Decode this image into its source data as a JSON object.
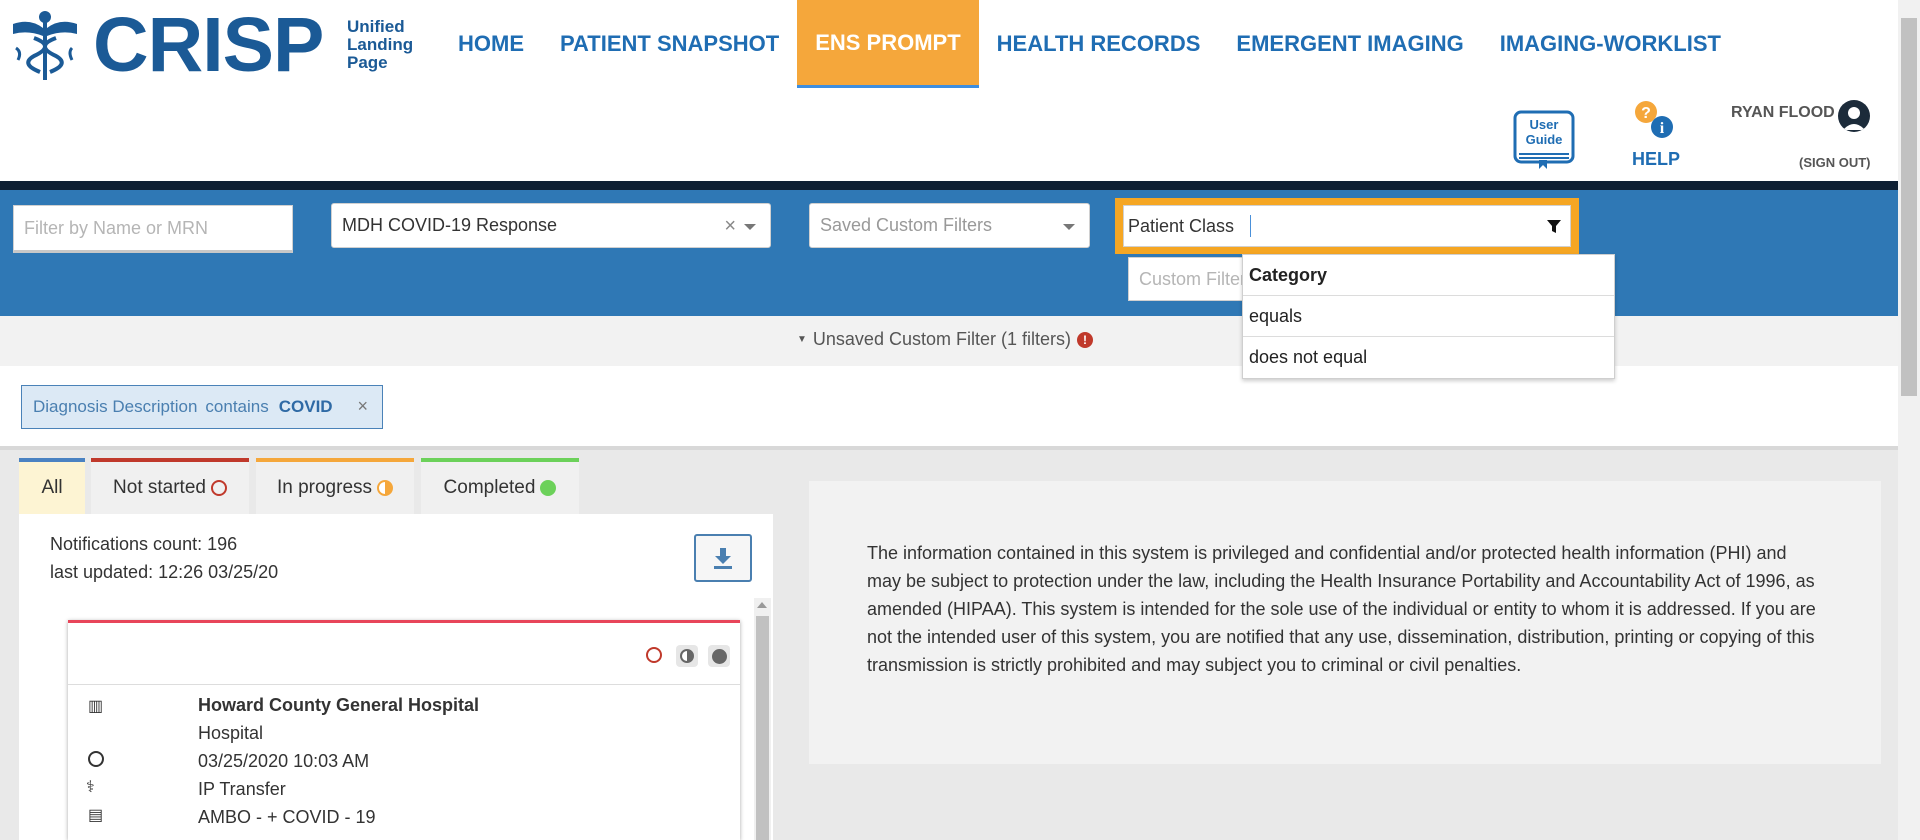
{
  "header": {
    "logo_text": "CRISP",
    "logo_sub": [
      "Unified",
      "Landing",
      "Page"
    ],
    "nav": [
      {
        "label": "HOME",
        "active": false
      },
      {
        "label": "PATIENT SNAPSHOT",
        "active": false
      },
      {
        "label": "ENS PROMPT",
        "active": true
      },
      {
        "label": "HEALTH RECORDS",
        "active": false
      },
      {
        "label": "EMERGENT IMAGING",
        "active": false
      },
      {
        "label": "IMAGING-WORKLIST",
        "active": false
      }
    ],
    "guide_label": [
      "User",
      "Guide"
    ],
    "help_label": "HELP",
    "user_name": "RYAN FLOOD",
    "sign_out": "(SIGN OUT)"
  },
  "filters": {
    "name_mrn_placeholder": "Filter by Name or MRN",
    "preset_value": "MDH COVID-19 Response",
    "preset_clear": "×",
    "saved_filters_placeholder": "Saved Custom Filters",
    "field_value": "Patient Class",
    "custom_filter_placeholder": "Custom Filter",
    "dropdown": {
      "header": "Category",
      "options": [
        "equals",
        "does not equal"
      ]
    }
  },
  "unsaved": {
    "label": "Unsaved Custom Filter (1 filters)",
    "chip": {
      "field": "Diagnosis Description",
      "operator": "contains",
      "value": "COVID",
      "remove": "×"
    }
  },
  "tabs": [
    {
      "label": "All",
      "color": "#4a82c2"
    },
    {
      "label": "Not started",
      "color": "#c0392b"
    },
    {
      "label": "In progress",
      "color": "#f5a73b"
    },
    {
      "label": "Completed",
      "color": "#6cd15a"
    }
  ],
  "notifications": {
    "count_text": "Notifications count: 196",
    "updated_text": "last updated: 12:26 03/25/20"
  },
  "card": {
    "facility": "Howard County General Hospital",
    "facility_type": "Hospital",
    "datetime": "03/25/2020 10:03 AM",
    "encounter": "IP Transfer",
    "diagnosis": "AMBO - + COVID - 19"
  },
  "disclaimer": "The information contained in this system is privileged and confidential and/or protected health information (PHI) and may be subject to protection under the law, including the Health Insurance Portability and Accountability Act of 1996, as amended (HIPAA). This system is intended for the sole use of the individual or entity to whom it is addressed. If you are not the intended user of this system, you are notified that any use, dissemination, distribution, printing or copying of this transmission is strictly prohibited and may subject you to criminal or civil penalties."
}
